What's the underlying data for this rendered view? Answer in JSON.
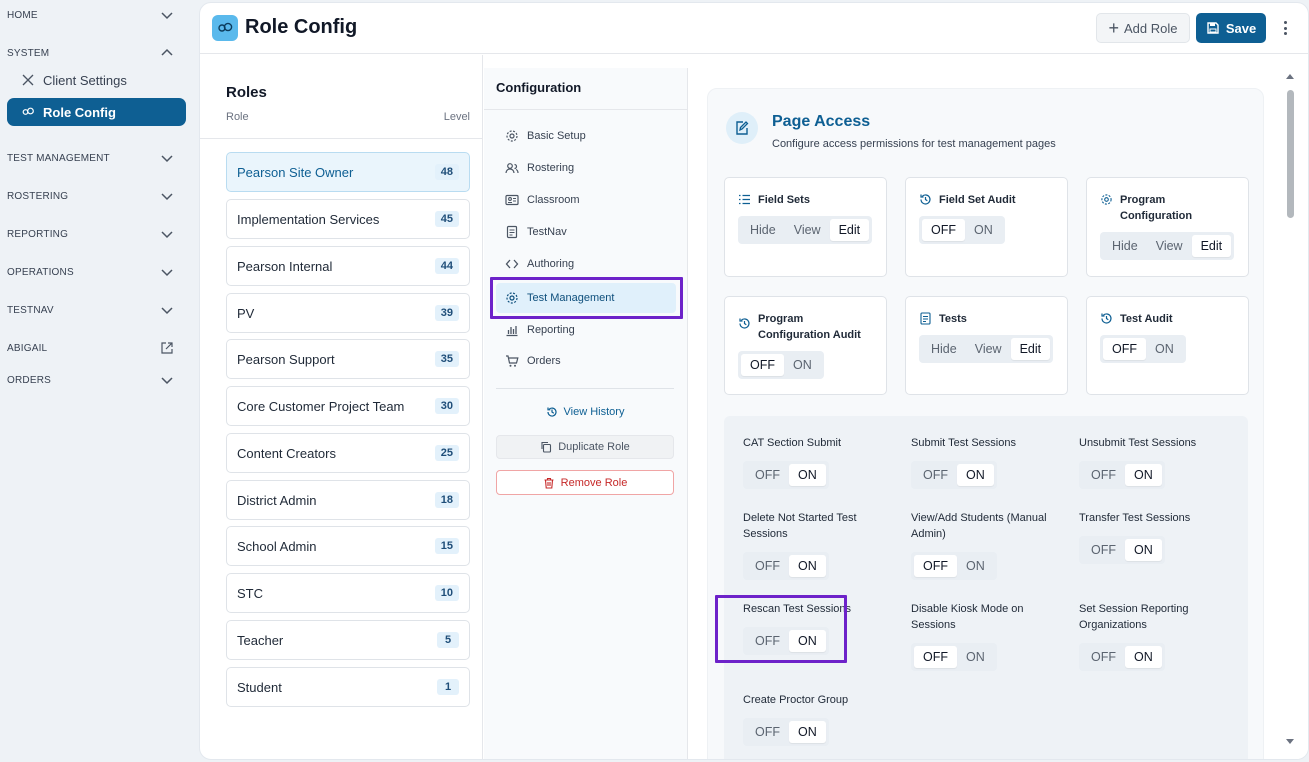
{
  "sidebar": {
    "home": "HOME",
    "system": "SYSTEM",
    "client_settings": "Client Settings",
    "role_config": "Role Config",
    "test_management": "TEST MANAGEMENT",
    "rostering": "ROSTERING",
    "reporting": "REPORTING",
    "operations": "OPERATIONS",
    "testnav": "TESTNAV",
    "abigail": "ABIGAIL",
    "orders": "ORDERS"
  },
  "header": {
    "title": "Role Config",
    "add_role": "Add Role",
    "save": "Save"
  },
  "roles": {
    "title": "Roles",
    "col_role": "Role",
    "col_level": "Level",
    "items": [
      {
        "name": "Pearson Site Owner",
        "level": "48"
      },
      {
        "name": "Implementation Services",
        "level": "45"
      },
      {
        "name": "Pearson Internal",
        "level": "44"
      },
      {
        "name": "PV",
        "level": "39"
      },
      {
        "name": "Pearson Support",
        "level": "35"
      },
      {
        "name": "Core Customer Project Team",
        "level": "30"
      },
      {
        "name": "Content Creators",
        "level": "25"
      },
      {
        "name": "District Admin",
        "level": "18"
      },
      {
        "name": "School Admin",
        "level": "15"
      },
      {
        "name": "STC",
        "level": "10"
      },
      {
        "name": "Teacher",
        "level": "5"
      },
      {
        "name": "Student",
        "level": "1"
      }
    ]
  },
  "config": {
    "title": "Configuration",
    "items": [
      "Basic Setup",
      "Rostering",
      "Classroom",
      "TestNav",
      "Authoring",
      "Test Management",
      "Reporting",
      "Orders"
    ],
    "view_history": "View History",
    "duplicate_role": "Duplicate Role",
    "remove_role": "Remove Role"
  },
  "page_access": {
    "title": "Page Access",
    "subtitle": "Configure access permissions for test management pages",
    "cards": [
      {
        "title": "Field Sets",
        "options": [
          "Hide",
          "View",
          "Edit"
        ],
        "selected": "Edit"
      },
      {
        "title": "Field Set Audit",
        "options": [
          "OFF",
          "ON"
        ],
        "selected": "OFF"
      },
      {
        "title": "Program Configuration",
        "options": [
          "Hide",
          "View",
          "Edit"
        ],
        "selected": "Edit"
      },
      {
        "title": "Program Configuration Audit",
        "options": [
          "OFF",
          "ON"
        ],
        "selected": "OFF"
      },
      {
        "title": "Tests",
        "options": [
          "Hide",
          "View",
          "Edit"
        ],
        "selected": "Edit"
      },
      {
        "title": "Test Audit",
        "options": [
          "OFF",
          "ON"
        ],
        "selected": "OFF"
      }
    ]
  },
  "toggles": [
    {
      "label": "CAT Section Submit",
      "off": "OFF",
      "on": "ON",
      "selected": "ON"
    },
    {
      "label": "Submit Test Sessions",
      "off": "OFF",
      "on": "ON",
      "selected": "ON"
    },
    {
      "label": "Unsubmit Test Sessions",
      "off": "OFF",
      "on": "ON",
      "selected": "ON"
    },
    {
      "label": "Delete Not Started Test Sessions",
      "off": "OFF",
      "on": "ON",
      "selected": "ON"
    },
    {
      "label": "View/Add Students (Manual Admin)",
      "off": "OFF",
      "on": "ON",
      "selected": "OFF"
    },
    {
      "label": "Transfer Test Sessions",
      "off": "OFF",
      "on": "ON",
      "selected": "ON"
    },
    {
      "label": "Rescan Test Sessions",
      "off": "OFF",
      "on": "ON",
      "selected": "ON"
    },
    {
      "label": "Disable Kiosk Mode on Sessions",
      "off": "OFF",
      "on": "ON",
      "selected": "OFF"
    },
    {
      "label": "Set Session Reporting Organizations",
      "off": "OFF",
      "on": "ON",
      "selected": "ON"
    },
    {
      "label": "Create Proctor Group",
      "off": "OFF",
      "on": "ON",
      "selected": "ON"
    }
  ],
  "colors": {
    "accent": "#0e5f93",
    "highlight": "#6d22c9",
    "danger": "#c62828"
  }
}
